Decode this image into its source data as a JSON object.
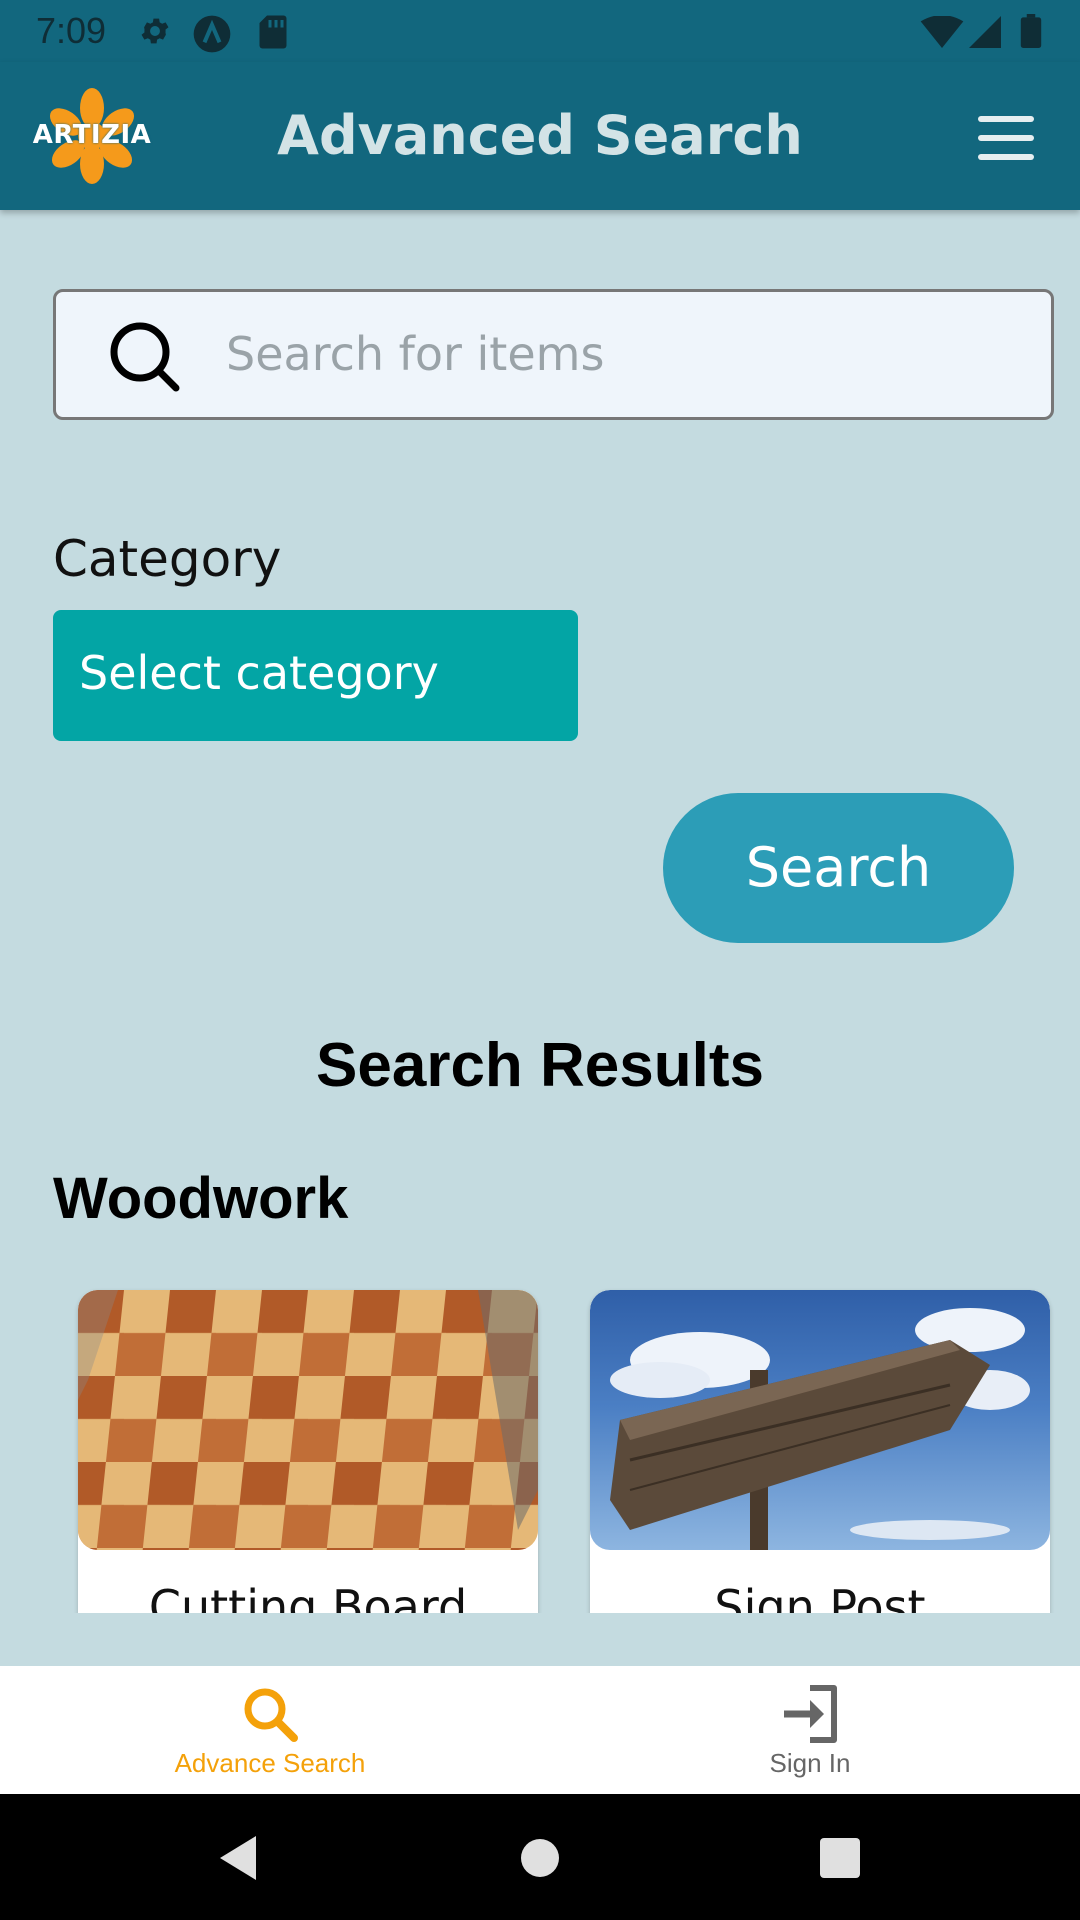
{
  "status_bar": {
    "time": "7:09",
    "icons": [
      "gear-icon",
      "a-icon",
      "sd-card-icon",
      "wifi-icon",
      "signal-icon",
      "battery-icon"
    ]
  },
  "app_bar": {
    "logo_text": "ARTIZIA",
    "title": "Advanced Search",
    "menu_icon": "hamburger-menu-icon",
    "color": "#12677e"
  },
  "search": {
    "placeholder": "Search for items",
    "value": "",
    "icon": "search-icon"
  },
  "category": {
    "label": "Category",
    "selected": "Select category",
    "color": "#03a5a5"
  },
  "search_button": {
    "label": "Search",
    "color": "#2c9db7"
  },
  "results": {
    "title": "Search Results",
    "section": "Woodwork",
    "items": [
      {
        "label": "Cutting Board"
      },
      {
        "label": "Sign Post"
      }
    ]
  },
  "bottom_nav": {
    "items": [
      {
        "label": "Advance Search",
        "icon": "search-icon",
        "active": true,
        "color": "#f4a10a"
      },
      {
        "label": "Sign In",
        "icon": "sign-in-icon",
        "active": false,
        "color": "#666666"
      }
    ]
  },
  "system_nav": {
    "icons": [
      "back-icon",
      "home-icon",
      "recents-icon"
    ]
  },
  "colors": {
    "background": "#c4dbe0"
  }
}
